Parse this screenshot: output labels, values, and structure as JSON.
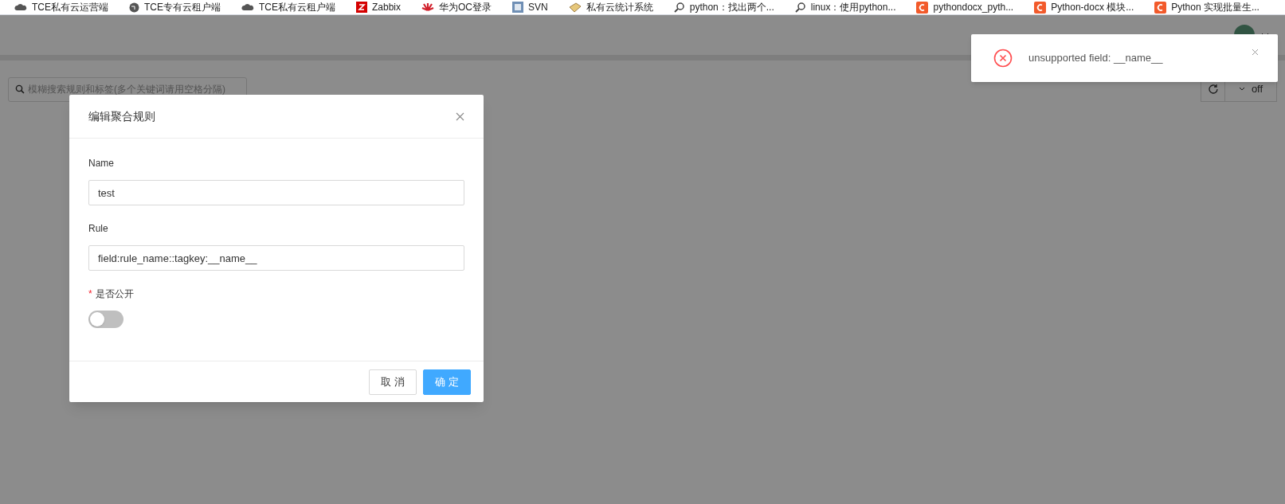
{
  "bookmarks": [
    {
      "label": "TCE私有云运营端",
      "kind": "cloud"
    },
    {
      "label": "TCE专有云租户端",
      "kind": "globe"
    },
    {
      "label": "TCE私有云租户端",
      "kind": "cloud"
    },
    {
      "label": "Zabbix",
      "kind": "z"
    },
    {
      "label": "华为OC登录",
      "kind": "flower"
    },
    {
      "label": "SVN",
      "kind": "svn"
    },
    {
      "label": "私有云统计系统",
      "kind": "book"
    },
    {
      "label": "python：找出两个...",
      "kind": "search"
    },
    {
      "label": "linux：使用python...",
      "kind": "search"
    },
    {
      "label": "pythondocx_pyth...",
      "kind": "c"
    },
    {
      "label": "Python-docx 模块...",
      "kind": "c"
    },
    {
      "label": "Python 实现批量生...",
      "kind": "c"
    }
  ],
  "search": {
    "placeholder": "模糊搜索规则和标签(多个关键词请用空格分隔)"
  },
  "auto_refresh": {
    "value": "off"
  },
  "dialog": {
    "title": "编辑聚合规则",
    "fields": [
      {
        "label": "Name",
        "value": "test"
      },
      {
        "label": "Rule",
        "value": "field:rule_name::tagkey:__name__"
      }
    ],
    "switch": {
      "required_mark": "*",
      "label": "是否公开",
      "on": false
    },
    "buttons": [
      {
        "label": "取 消",
        "primary": false
      },
      {
        "label": "确 定",
        "primary": true
      }
    ]
  },
  "toast": {
    "message": "unsupported field: __name__"
  }
}
